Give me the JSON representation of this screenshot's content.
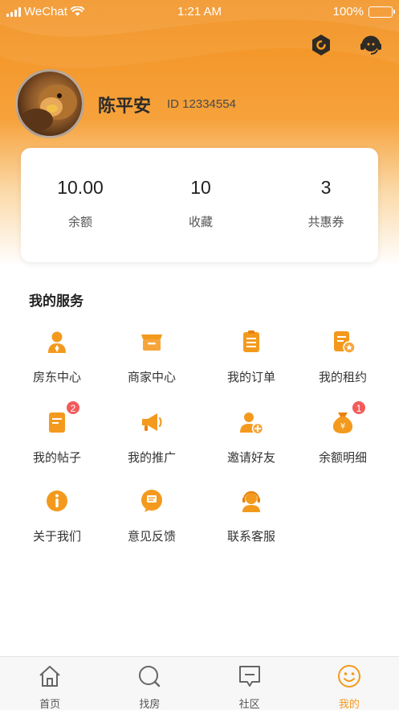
{
  "status_bar": {
    "carrier": "WeChat",
    "time": "1:21 AM",
    "battery": "100%"
  },
  "profile": {
    "name": "陈平安",
    "id_text": "ID 12334554"
  },
  "stats": [
    {
      "value": "10.00",
      "label": "余额"
    },
    {
      "value": "10",
      "label": "收藏"
    },
    {
      "value": "3",
      "label": "共惠券"
    }
  ],
  "services": {
    "title": "我的服务",
    "items": [
      {
        "label": "房东中心",
        "icon": "landlord-icon"
      },
      {
        "label": "商家中心",
        "icon": "store-icon"
      },
      {
        "label": "我的订单",
        "icon": "order-icon"
      },
      {
        "label": "我的租约",
        "icon": "lease-icon"
      },
      {
        "label": "我的帖子",
        "icon": "post-icon",
        "badge": "2"
      },
      {
        "label": "我的推广",
        "icon": "megaphone-icon"
      },
      {
        "label": "邀请好友",
        "icon": "invite-friend-icon"
      },
      {
        "label": "余额明细",
        "icon": "money-bag-icon",
        "badge": "1"
      },
      {
        "label": "关于我们",
        "icon": "info-icon"
      },
      {
        "label": "意见反馈",
        "icon": "feedback-icon"
      },
      {
        "label": "联系客服",
        "icon": "customer-service-icon"
      }
    ]
  },
  "tabbar": [
    {
      "label": "首页",
      "icon": "home-icon"
    },
    {
      "label": "找房",
      "icon": "search-icon"
    },
    {
      "label": "社区",
      "icon": "community-icon"
    },
    {
      "label": "我的",
      "icon": "profile-smile-icon",
      "active": true
    }
  ],
  "colors": {
    "accent": "#f39a1e",
    "accent_dark": "#e8820c",
    "badge": "#f25b5b",
    "text": "#333333"
  }
}
